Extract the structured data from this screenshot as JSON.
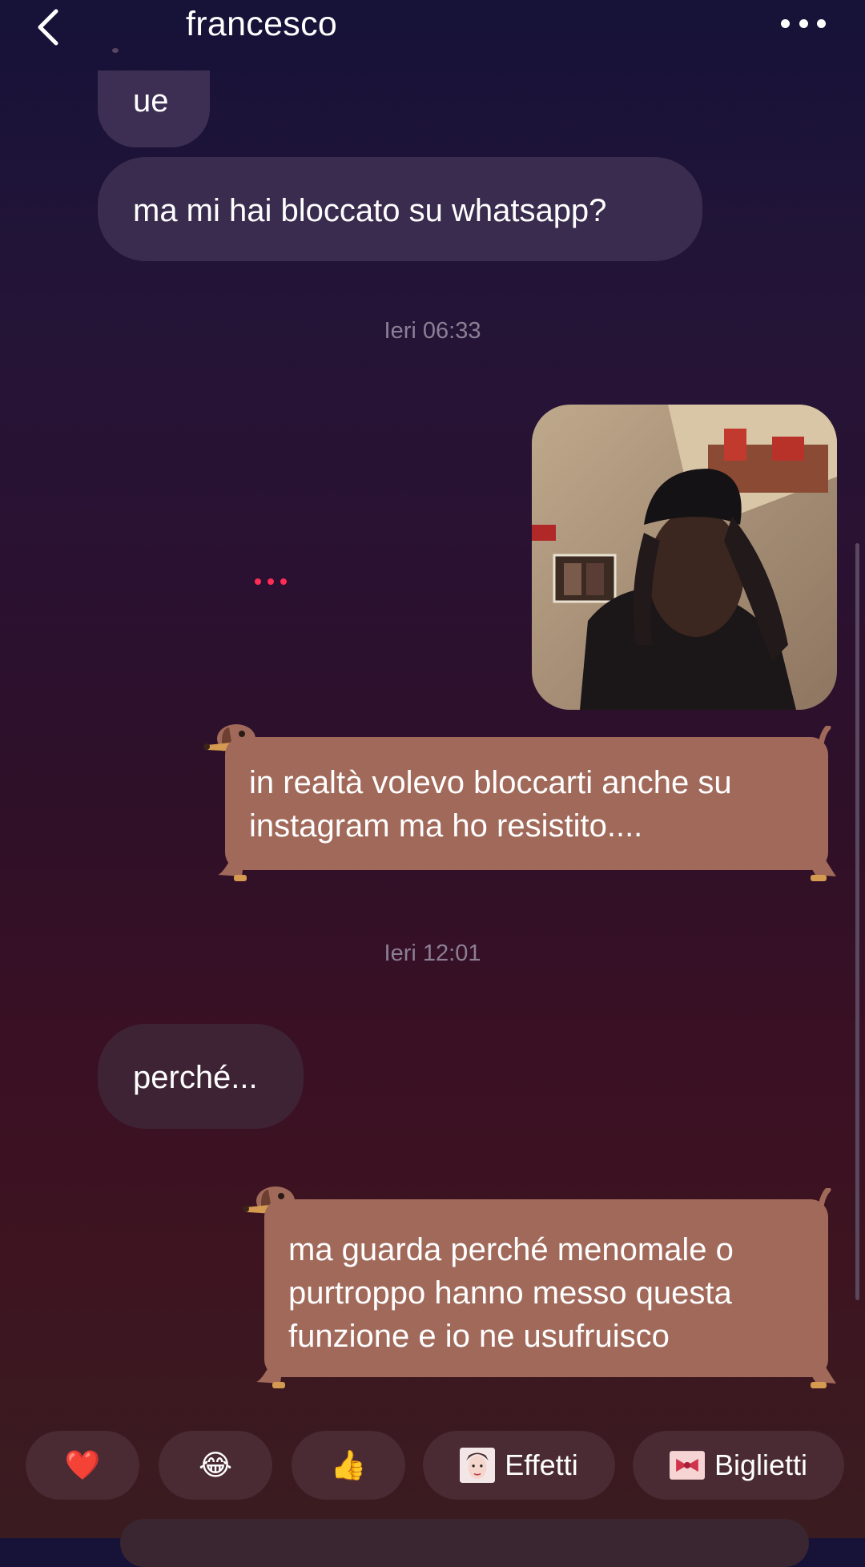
{
  "header": {
    "contact_name": "francesco"
  },
  "messages": {
    "in1": "ue",
    "in2": "ma mi hai bloccato su whatsapp?",
    "ts1": "Ieri 06:33",
    "out1": "in realtà volevo bloccarti anche su instagram ma ho resistito....",
    "ts2": "Ieri 12:01",
    "in3": "perché...",
    "out2": "ma guarda perché menomale o purtroppo hanno messo questa funzione e io ne usufruisco"
  },
  "quick_replies": {
    "heart": "❤️",
    "laugh": "😂",
    "thumbs": "👍",
    "effects": "Effetti",
    "cards": "Biglietti"
  },
  "icons": {
    "back": "chevron-left-icon",
    "more": "more-horizontal-icon",
    "effects": "face-filter-icon",
    "cards": "ribbon-card-icon"
  },
  "colors": {
    "incoming_bubble": "#3d2f53",
    "outgoing_bubble": "#a1695a",
    "typing_dots": "#ff2c55"
  }
}
